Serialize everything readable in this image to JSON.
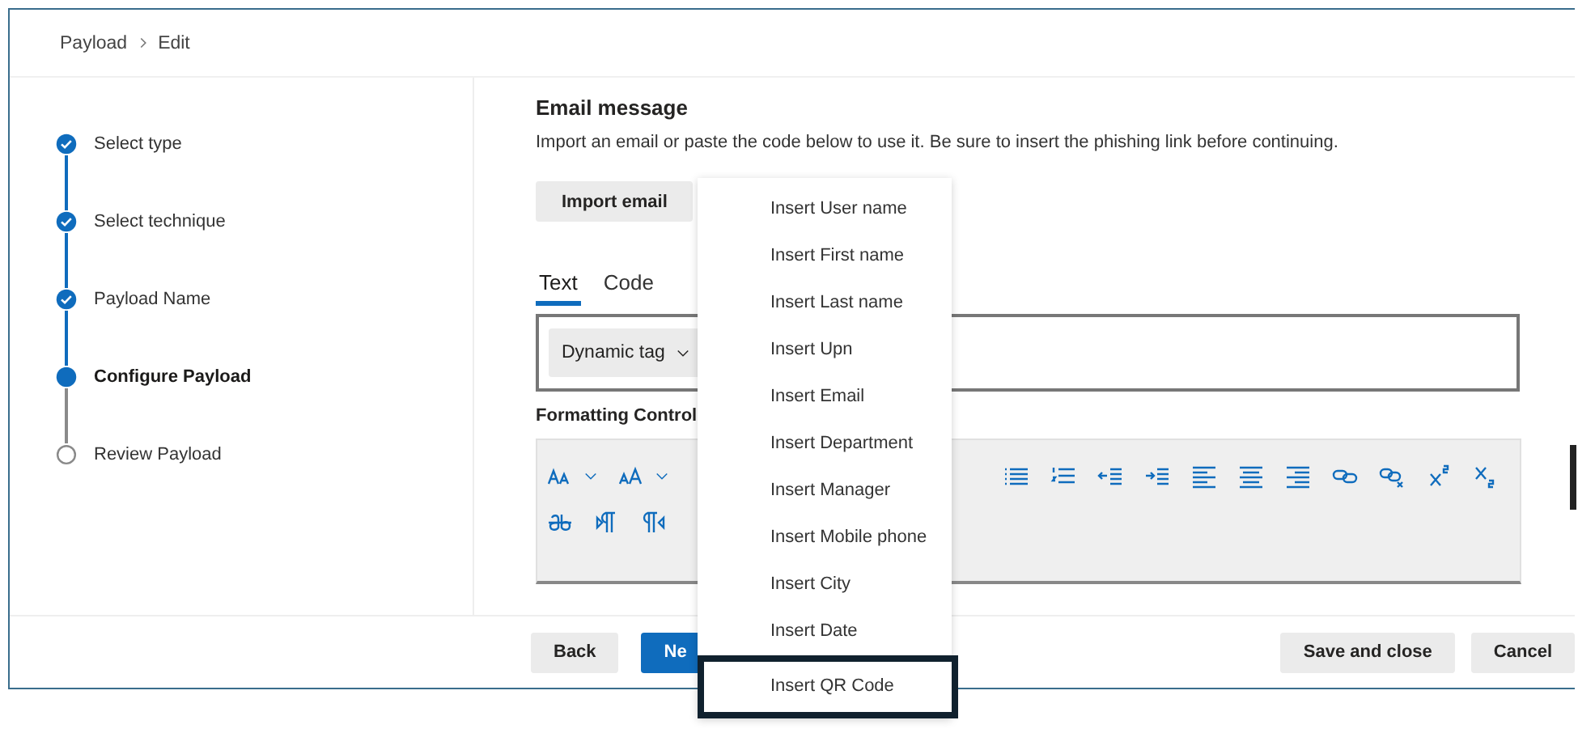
{
  "breadcrumb": [
    "Payload",
    "Edit"
  ],
  "steps": [
    {
      "label": "Select type",
      "completed": true,
      "current": false
    },
    {
      "label": "Select technique",
      "completed": true,
      "current": false
    },
    {
      "label": "Payload Name",
      "completed": true,
      "current": false
    },
    {
      "label": "Configure Payload",
      "completed": false,
      "current": true
    },
    {
      "label": "Review Payload",
      "completed": false,
      "current": false
    }
  ],
  "section": {
    "title": "Email message",
    "description": "Import an email or paste the code below to use it. Be sure to insert the phishing link before continuing."
  },
  "import_button": "Import email",
  "tabs": [
    {
      "label": "Text",
      "selected": true
    },
    {
      "label": "Code",
      "selected": false
    }
  ],
  "dynamic_tag_button": "Dynamic tag",
  "formatting_label": "Formatting Control",
  "dynamic_tag_menu": [
    {
      "label": "Insert User name",
      "highlighted": false
    },
    {
      "label": "Insert First name",
      "highlighted": false
    },
    {
      "label": "Insert Last name",
      "highlighted": false
    },
    {
      "label": "Insert Upn",
      "highlighted": false
    },
    {
      "label": "Insert Email",
      "highlighted": false
    },
    {
      "label": "Insert Department",
      "highlighted": false
    },
    {
      "label": "Insert Manager",
      "highlighted": false
    },
    {
      "label": "Insert Mobile phone",
      "highlighted": false
    },
    {
      "label": "Insert City",
      "highlighted": false
    },
    {
      "label": "Insert Date",
      "highlighted": false
    },
    {
      "label": "Insert QR Code",
      "highlighted": true
    }
  ],
  "footer": [
    {
      "label": "Back",
      "kind": "default"
    },
    {
      "label": "Ne",
      "kind": "primary"
    },
    {
      "label": "Save and close",
      "kind": "default"
    },
    {
      "label": "Cancel",
      "kind": "default"
    }
  ]
}
